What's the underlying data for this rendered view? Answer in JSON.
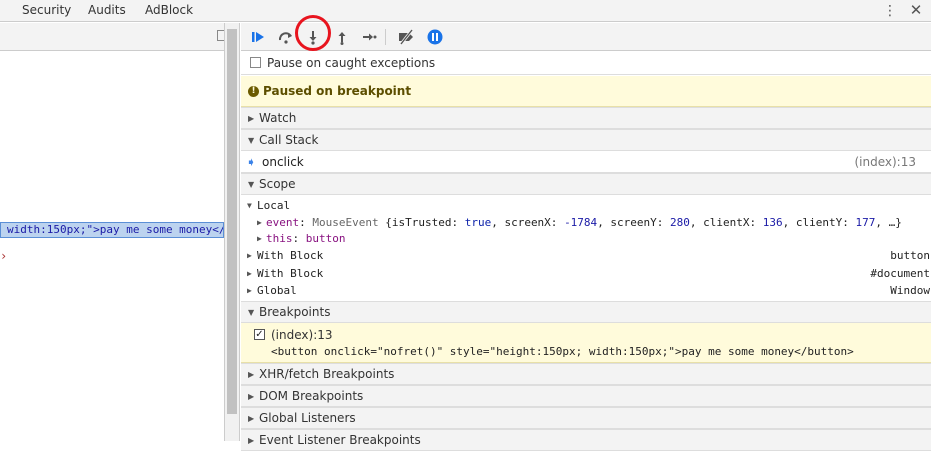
{
  "tabs": [
    "Security",
    "Audits",
    "AdBlock"
  ],
  "tabbar": {
    "more_icon": "⋮",
    "close_icon": "✕"
  },
  "left_pane": {
    "code_line": "width:150px;\">pay me some money</",
    "caret": "›"
  },
  "toolbar": {
    "buttons": [
      "resume-icon",
      "step-over-icon",
      "step-into-icon",
      "step-out-icon",
      "step-icon",
      "deactivate-breakpoints-icon",
      "pause-on-exceptions-icon"
    ],
    "accent": "#1a73e8",
    "highlight": "#e8141e"
  },
  "pause_caught_label": "Pause on caught exceptions",
  "paused_banner": {
    "icon": "!",
    "text": "Paused on breakpoint"
  },
  "sections": {
    "watch": "Watch",
    "call_stack": "Call Stack",
    "scope": "Scope",
    "breakpoints": "Breakpoints",
    "xhr": "XHR/fetch Breakpoints",
    "dom": "DOM Breakpoints",
    "global": "Global Listeners",
    "event": "Event Listener Breakpoints"
  },
  "call_stack": {
    "frame": "onclick",
    "location": "(index):13"
  },
  "scope": {
    "local_label": "Local",
    "event_key": "event",
    "event_type": "MouseEvent",
    "event_p1": " {isTrusted: ",
    "event_true": "true",
    "event_p2": ", screenX: ",
    "screenX": "-1784",
    "event_p3": ", screenY: ",
    "screenY": "280",
    "event_p4": ", clientX: ",
    "clientX": "136",
    "event_p5": ", clientY: ",
    "clientY": "177",
    "event_p6": ", …}",
    "this_key": "this",
    "this_val": "button",
    "with_block_1": "With Block",
    "with_block_1_val": "button",
    "with_block_2": "With Block",
    "with_block_2_val": "#document",
    "global": "Global",
    "global_val": "Window"
  },
  "breakpoint": {
    "checked": true,
    "check_mark": "✓",
    "location": "(index):13",
    "code": "<button onclick=\"nofret()\" style=\"height:150px; width:150px;\">pay me some money</button>"
  }
}
